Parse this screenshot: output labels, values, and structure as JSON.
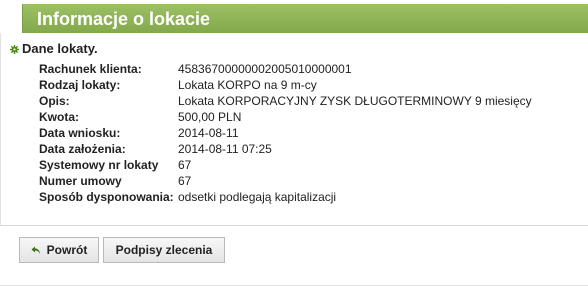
{
  "header": {
    "title": "Informacje o lokacie"
  },
  "section": {
    "title": "Dane lokaty.",
    "icon": "gear-icon"
  },
  "details": [
    {
      "label": "Rachunek klienta:",
      "value": "45836700000002005010000001"
    },
    {
      "label": "Rodzaj lokaty:",
      "value": "Lokata KORPO na 9 m-cy"
    },
    {
      "label": "Opis:",
      "value": "Lokata KORPORACYJNY ZYSK DŁUGOTERMINOWY 9 miesięcy"
    },
    {
      "label": "Kwota:",
      "value": "500,00 PLN"
    },
    {
      "label": "Data wniosku:",
      "value": "2014-08-11"
    },
    {
      "label": "Data założenia:",
      "value": "2014-08-11 07:25"
    },
    {
      "label": "Systemowy nr lokaty",
      "value": "67"
    },
    {
      "label": "Numer umowy",
      "value": "67"
    },
    {
      "label": "Sposób dysponowania:",
      "value": "odsetki podlegają kapitalizacji"
    }
  ],
  "buttons": {
    "back_label": "Powrót",
    "back_icon": "back-arrow-icon",
    "signatures_label": "Podpisy zlecenia"
  },
  "colors": {
    "header_bg": "#8fb358",
    "icon_green": "#4c8a1e"
  }
}
